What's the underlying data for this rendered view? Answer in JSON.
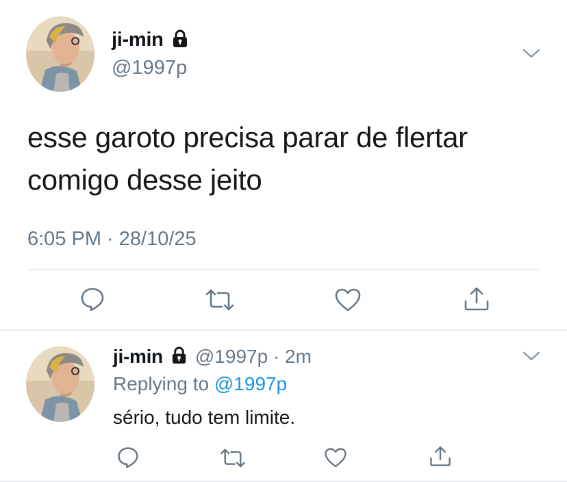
{
  "main_tweet": {
    "author": {
      "display_name": "ji-min",
      "handle": "@1997p",
      "protected_icon": "lock-icon",
      "avatar": "profile-photo"
    },
    "text_line1": "esse garoto precisa parar de flertar",
    "text_line2": "comigo desse jeito",
    "timestamp": "6:05 PM · 28/10/25",
    "actions": [
      "reply-icon",
      "retweet-icon",
      "like-icon",
      "share-icon"
    ],
    "menu_icon": "chevron-down-icon"
  },
  "reply_tweet": {
    "author": {
      "display_name": "ji-min",
      "protected_icon": "lock-icon",
      "handle_time": "@1997p · 2m",
      "avatar": "profile-photo"
    },
    "replying_prefix": "Replying to",
    "replying_to": "@1997p",
    "text": "sério, tudo tem limite.",
    "actions": [
      "reply-icon",
      "retweet-icon",
      "like-icon",
      "share-icon"
    ],
    "menu_icon": "chevron-down-icon"
  },
  "colors": {
    "text": "#14171a",
    "secondary": "#657786",
    "link": "#1b95e0",
    "divider": "#e1e8ed",
    "icon": "#657786"
  }
}
